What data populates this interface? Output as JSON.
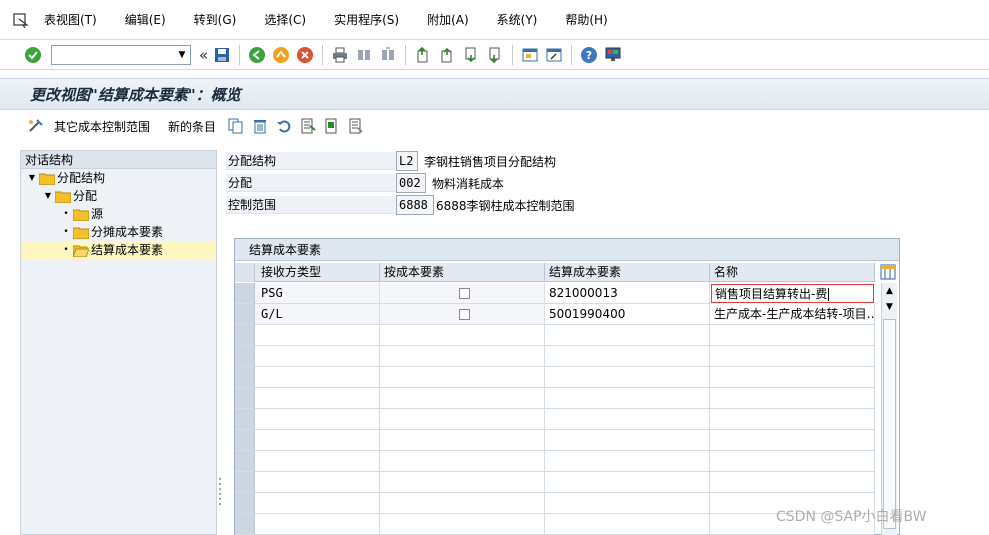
{
  "menubar": {
    "items": [
      "表视图(T)",
      "编辑(E)",
      "转到(G)",
      "选择(C)",
      "实用程序(S)",
      "附加(A)",
      "系统(Y)",
      "帮助(H)"
    ]
  },
  "toolbar": {
    "command_value": ""
  },
  "title": "更改视图\"结算成本要素\"：概览",
  "app_toolbar": {
    "other_area_label": "其它成本控制范围",
    "new_entries_label": "新的条目"
  },
  "tree": {
    "header": "对话结构",
    "nodes": [
      {
        "label": "分配结构",
        "level": 0
      },
      {
        "label": "分配",
        "level": 1
      },
      {
        "label": "源",
        "level": 2
      },
      {
        "label": "分摊成本要素",
        "level": 2
      },
      {
        "label": "结算成本要素",
        "level": 2
      }
    ]
  },
  "header_fields": [
    {
      "label": "分配结构",
      "value": "L2",
      "desc": "李钢柱销售项目分配结构"
    },
    {
      "label": "分配",
      "value": "002",
      "desc": "物料消耗成本"
    },
    {
      "label": "控制范围",
      "value": "6888",
      "desc": "6888李钢柱成本控制范围"
    }
  ],
  "table": {
    "caption": "结算成本要素",
    "columns": [
      "接收方类型",
      "按成本要素",
      "结算成本要素",
      "名称"
    ],
    "rows": [
      {
        "receiver": "PSG",
        "checked": false,
        "element": "821000013",
        "name": "销售项目结算转出-费"
      },
      {
        "receiver": "G/L",
        "checked": false,
        "element": "5001990400",
        "name": "生产成本-生产成本结转-项目…"
      }
    ],
    "empty_rows": 10
  },
  "watermark": "CSDN @SAP小白看BW",
  "colors": {
    "title_bg": "#dfe8f1",
    "tree_bg": "#eef2f7",
    "selected_node": "#fff7c2",
    "focus_corner": "#e03a3a"
  }
}
